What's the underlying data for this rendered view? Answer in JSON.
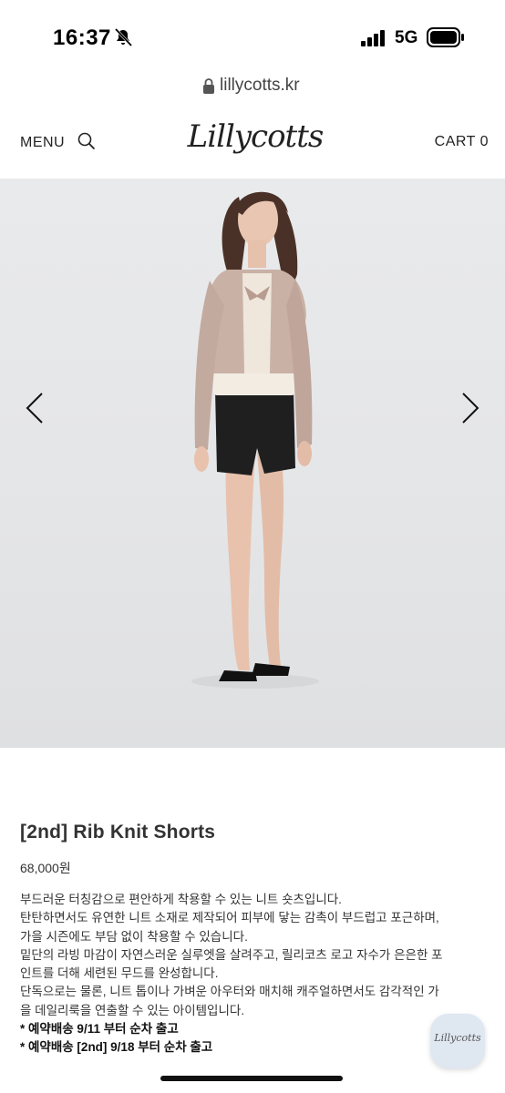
{
  "status_bar": {
    "time": "16:37",
    "network": "5G",
    "icons": [
      "bell-muted-icon",
      "signal-icon",
      "battery-icon"
    ]
  },
  "browser": {
    "url": "lillycotts.kr",
    "icon": "lock-icon"
  },
  "header": {
    "menu_label": "MENU",
    "brand": "Lillycotts",
    "cart_label": "CART 0",
    "icons": [
      "search-icon"
    ]
  },
  "hero": {
    "icons": [
      "chevron-left-icon",
      "chevron-right-icon"
    ]
  },
  "product": {
    "title": "[2nd] Rib Knit Shorts",
    "price": "68,000원",
    "description": [
      "부드러운 터칭감으로 편안하게 착용할 수 있는 니트 숏츠입니다.",
      "탄탄하면서도 유연한 니트 소재로 제작되어 피부에 닿는 감촉이 부드럽고 포근하며,",
      "가을 시즌에도 부담 없이 착용할 수 있습니다.",
      "밑단의 라빙 마감이 자연스러운 실루엣을 살려주고, 릴리코츠 로고 자수가 은은한 포",
      "인트를 더해 세련된 무드를 완성합니다.",
      "단독으로는 물론, 니트 톱이나 가벼운 아우터와 매치해 캐주얼하면서도 감각적인 가",
      "을 데일리룩을 연출할 수 있는 아이템입니다."
    ],
    "notes": [
      "* 예약배송 9/11 부터 순차 출고",
      "* 예약배송 [2nd] 9/18 부터 순차 출고"
    ]
  },
  "floating_badge": {
    "label": "Lillycotts"
  }
}
